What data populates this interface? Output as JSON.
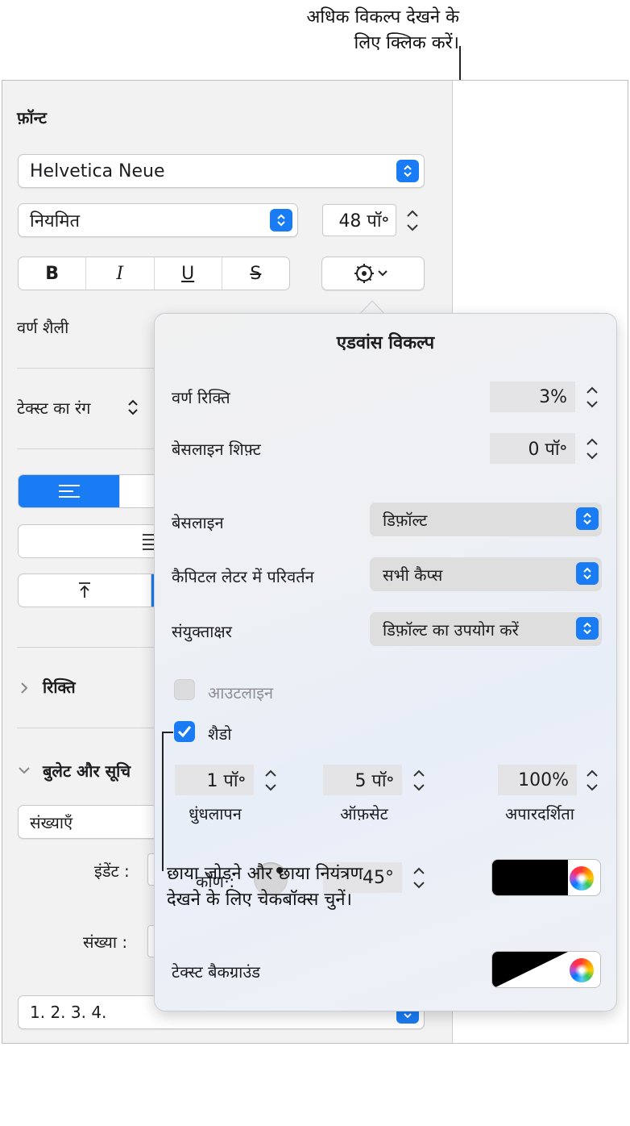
{
  "callouts": {
    "top": [
      "अधिक विकल्प देखने के",
      "लिए क्लिक करें।"
    ],
    "bottom": [
      "छाया जोड़ने और छाया नियंत्रण",
      "देखने के लिए चेकबॉक्स चुनें।"
    ]
  },
  "sidebar": {
    "font_title": "फ़ॉन्ट",
    "font_family": "Helvetica Neue",
    "font_style": "नियमित",
    "font_size": "48 पॉ॰",
    "format_buttons": [
      "B",
      "I",
      "U",
      "S"
    ],
    "char_style_label": "वर्ण शैली",
    "text_color_label": "टेक्स्ट का रंग",
    "spacing_label": "रिक्ति",
    "bullets_label": "बुलेट और सूचि",
    "numbers_popup": "संख्याएँ",
    "indent_label": "इंडेंट :",
    "number_label": "संख्या :",
    "number_format": "1. 2. 3. 4."
  },
  "advanced": {
    "title": "एडवांस विकल्प",
    "char_spacing_label": "वर्ण रिक्ति",
    "char_spacing_value": "3%",
    "baseline_shift_label": "बेसलाइन शिफ़्ट",
    "baseline_shift_value": "0 पॉ॰",
    "baseline_label": "बेसलाइन",
    "baseline_value": "डिफ़ॉल्ट",
    "caps_label": "कैपिटल लेटर में परिवर्तन",
    "caps_value": "सभी कैप्स",
    "ligatures_label": "संयुक्ताक्षर",
    "ligatures_value": "डिफ़ॉल्ट का उपयोग करें",
    "outline_label": "आउटलाइन",
    "outline_checked": false,
    "shadow_label": "शैडो",
    "shadow_checked": true,
    "blur_value": "1 पॉ॰",
    "blur_label": "धुंधलापन",
    "offset_value": "5 पॉ॰",
    "offset_label": "ऑफ़सेट",
    "opacity_value": "100%",
    "opacity_label": "अपारदर्शिता",
    "angle_label": "कोण :",
    "angle_value": "45°",
    "shadow_color": "#000000",
    "text_background_label": "टेक्स्ट बैकग्राउंड"
  },
  "colors": {
    "accent": "#1a7cf5",
    "segment_selected": "#1a7cf5"
  }
}
